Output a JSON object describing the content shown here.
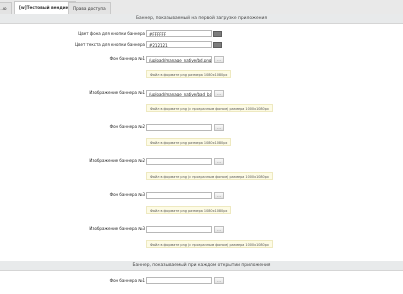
{
  "tabs": [
    "...ю",
    "[w]Тестовый вендинг",
    "Права доступа"
  ],
  "sections": {
    "first_launch": "Баннер, показываемый на первой загрузке приложения",
    "every_open": "Баннер, показываемый при каждом открытии приложения"
  },
  "fields": {
    "btn_bg_color": {
      "label": "Цвет фона для кнопки баннера",
      "value": "#FFFFFF"
    },
    "btn_text_color": {
      "label": "Цвет текста для кнопки баннера",
      "value": "#212121"
    },
    "banner1_bg": {
      "label": "Фон баннера №1",
      "value": "/upload/manage_native/bd.png"
    },
    "banner1_img": {
      "label": "Изображение баннера №1",
      "value": "/upload/manage_native/bad_banner"
    },
    "banner2_bg": {
      "label": "Фон баннера №2",
      "value": ""
    },
    "banner2_img": {
      "label": "Изображение баннера №2",
      "value": ""
    },
    "banner3_bg": {
      "label": "Фон баннера №3",
      "value": ""
    },
    "banner3_img": {
      "label": "Изображение баннера №3",
      "value": ""
    },
    "banner1_bg_every": {
      "label": "Фон баннера №1",
      "value": ""
    }
  },
  "hints": {
    "bg": "Файл в формате png размера 1080x1080px",
    "img": "Файл в формате png (с прозрачным фоном) размера 1000x1080px"
  },
  "buttons": {
    "browse": "..."
  },
  "colors": {
    "swatch": "#7d7d7d",
    "hint_bg": "#fdfbe5"
  }
}
